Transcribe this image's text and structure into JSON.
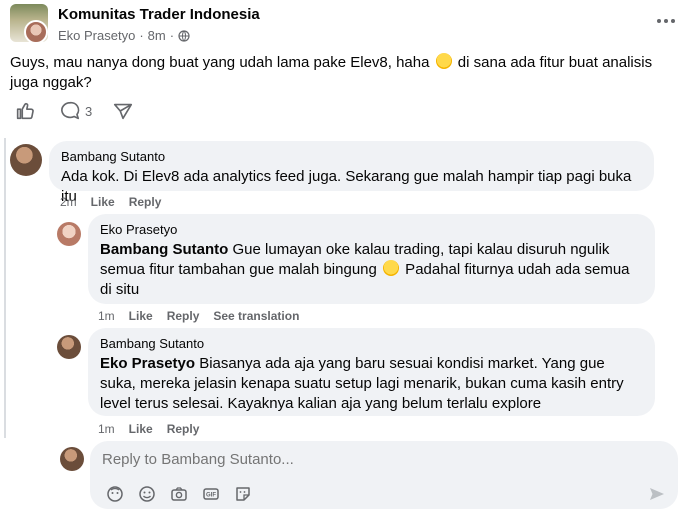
{
  "post": {
    "group_name": "Komunitas Trader Indonesia",
    "author": "Eko Prasetyo",
    "separator": "·",
    "time": "8m",
    "text_before_emoji": "Guys, mau nanya dong buat yang udah lama pake Elev8, haha ",
    "text_after_emoji": " di sana ada fitur buat analisis juga nggak?",
    "comment_count": "3"
  },
  "comments": [
    {
      "author": "Bambang Sutanto",
      "mention": "",
      "text": "Ada kok. Di Elev8 ada analytics feed juga. Sekarang gue malah hampir tiap pagi buka itu",
      "time": "2m",
      "like": "Like",
      "reply": "Reply"
    },
    {
      "author": "Eko Prasetyo",
      "mention": "Bambang Sutanto",
      "text_before_emoji": " Gue lumayan oke kalau trading, tapi kalau disuruh ngulik semua fitur tambahan gue malah bingung ",
      "text_after_emoji": " Padahal fiturnya udah ada semua di situ",
      "time": "1m",
      "like": "Like",
      "reply": "Reply",
      "translate": "See translation"
    },
    {
      "author": "Bambang Sutanto",
      "mention": "Eko Prasetyo",
      "text": " Biasanya ada aja yang baru sesuai kondisi market. Yang gue suka, mereka jelasin kenapa suatu setup lagi menarik, bukan cuma kasih entry level terus selesai. Kayaknya kalian aja yang belum terlalu explore",
      "time": "1m",
      "like": "Like",
      "reply": "Reply"
    }
  ],
  "reply_box": {
    "placeholder": "Reply to Bambang Sutanto..."
  },
  "icons": {
    "more": "more-dots-icon",
    "globe": "globe-icon",
    "like": "thumbs-up-icon",
    "comment": "comment-bubble-icon",
    "share": "share-icon",
    "avatar_sticker": "avatar-sticker-icon",
    "emoji": "emoji-icon",
    "camera": "camera-icon",
    "gif": "gif-icon",
    "sticker": "sticker-icon",
    "send": "send-icon"
  }
}
